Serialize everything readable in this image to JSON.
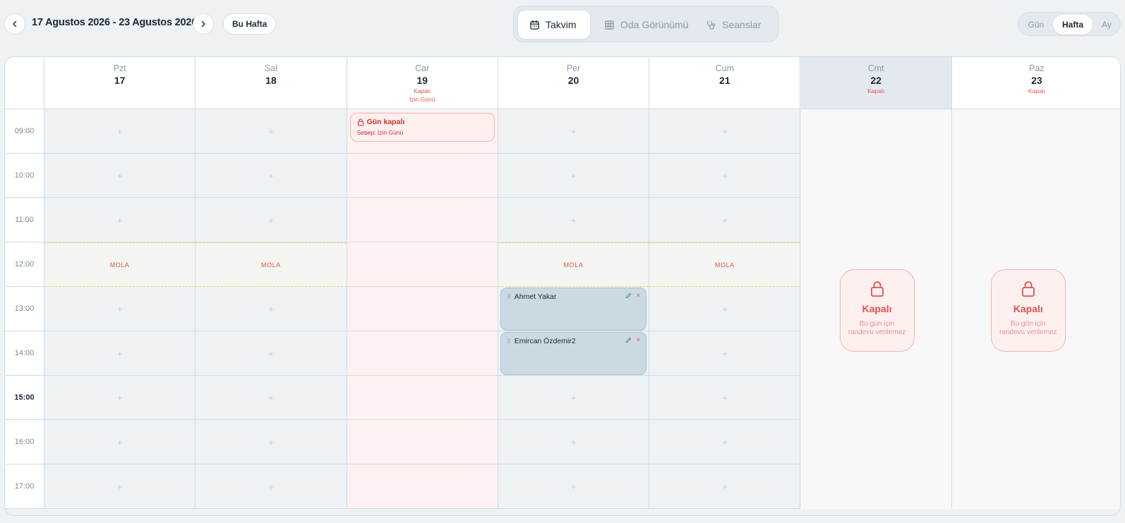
{
  "toolbar": {
    "range_title": "17 Agustos 2026 - 23 Agustos 2026",
    "today_label": "Bu Hafta"
  },
  "view_tabs": [
    {
      "label": "Takvim",
      "icon": "calendar-icon",
      "active": true
    },
    {
      "label": "Oda Görünümü",
      "icon": "grid-icon",
      "active": false
    },
    {
      "label": "Seanslar",
      "icon": "stethoscope-icon",
      "active": false
    }
  ],
  "range_tabs": [
    {
      "label": "Gün",
      "active": false
    },
    {
      "label": "Hafta",
      "active": true
    },
    {
      "label": "Ay",
      "active": false
    }
  ],
  "hours": [
    "09:00",
    "10:00",
    "11:00",
    "12:00",
    "13:00",
    "14:00",
    "15:00",
    "16:00",
    "17:00"
  ],
  "current_hour": "15:00",
  "days": [
    {
      "name": "Pzt",
      "num": "17"
    },
    {
      "name": "Sal",
      "num": "18"
    },
    {
      "name": "Car",
      "num": "19",
      "closed_label": "Kapalı",
      "closed_reason": "İzin Günü"
    },
    {
      "name": "Per",
      "num": "20"
    },
    {
      "name": "Cum",
      "num": "21"
    },
    {
      "name": "Cmt",
      "num": "22",
      "closed_label": "Kapalı"
    },
    {
      "name": "Paz",
      "num": "23",
      "closed_label": "Kapalı"
    }
  ],
  "add_symbol": "+",
  "break_label": "MOLA",
  "closed_day_banner": {
    "title": "Gün kapalı",
    "reason": "Sebep: İzin Günü"
  },
  "appointments": [
    {
      "name": "Ahmet Yakar",
      "day": "Per",
      "hour": "13:00"
    },
    {
      "name": "Emircan Özdemir2",
      "day": "Per",
      "hour": "14:00"
    }
  ],
  "weekend_card": {
    "title": "Kapalı",
    "subtitle_line1": "Bu gün için",
    "subtitle_line2": "randevu verilemez"
  },
  "colors": {
    "closed_red": "#e0534d",
    "appointment_bg": "#cbdae2",
    "break_border": "#f0d660"
  }
}
